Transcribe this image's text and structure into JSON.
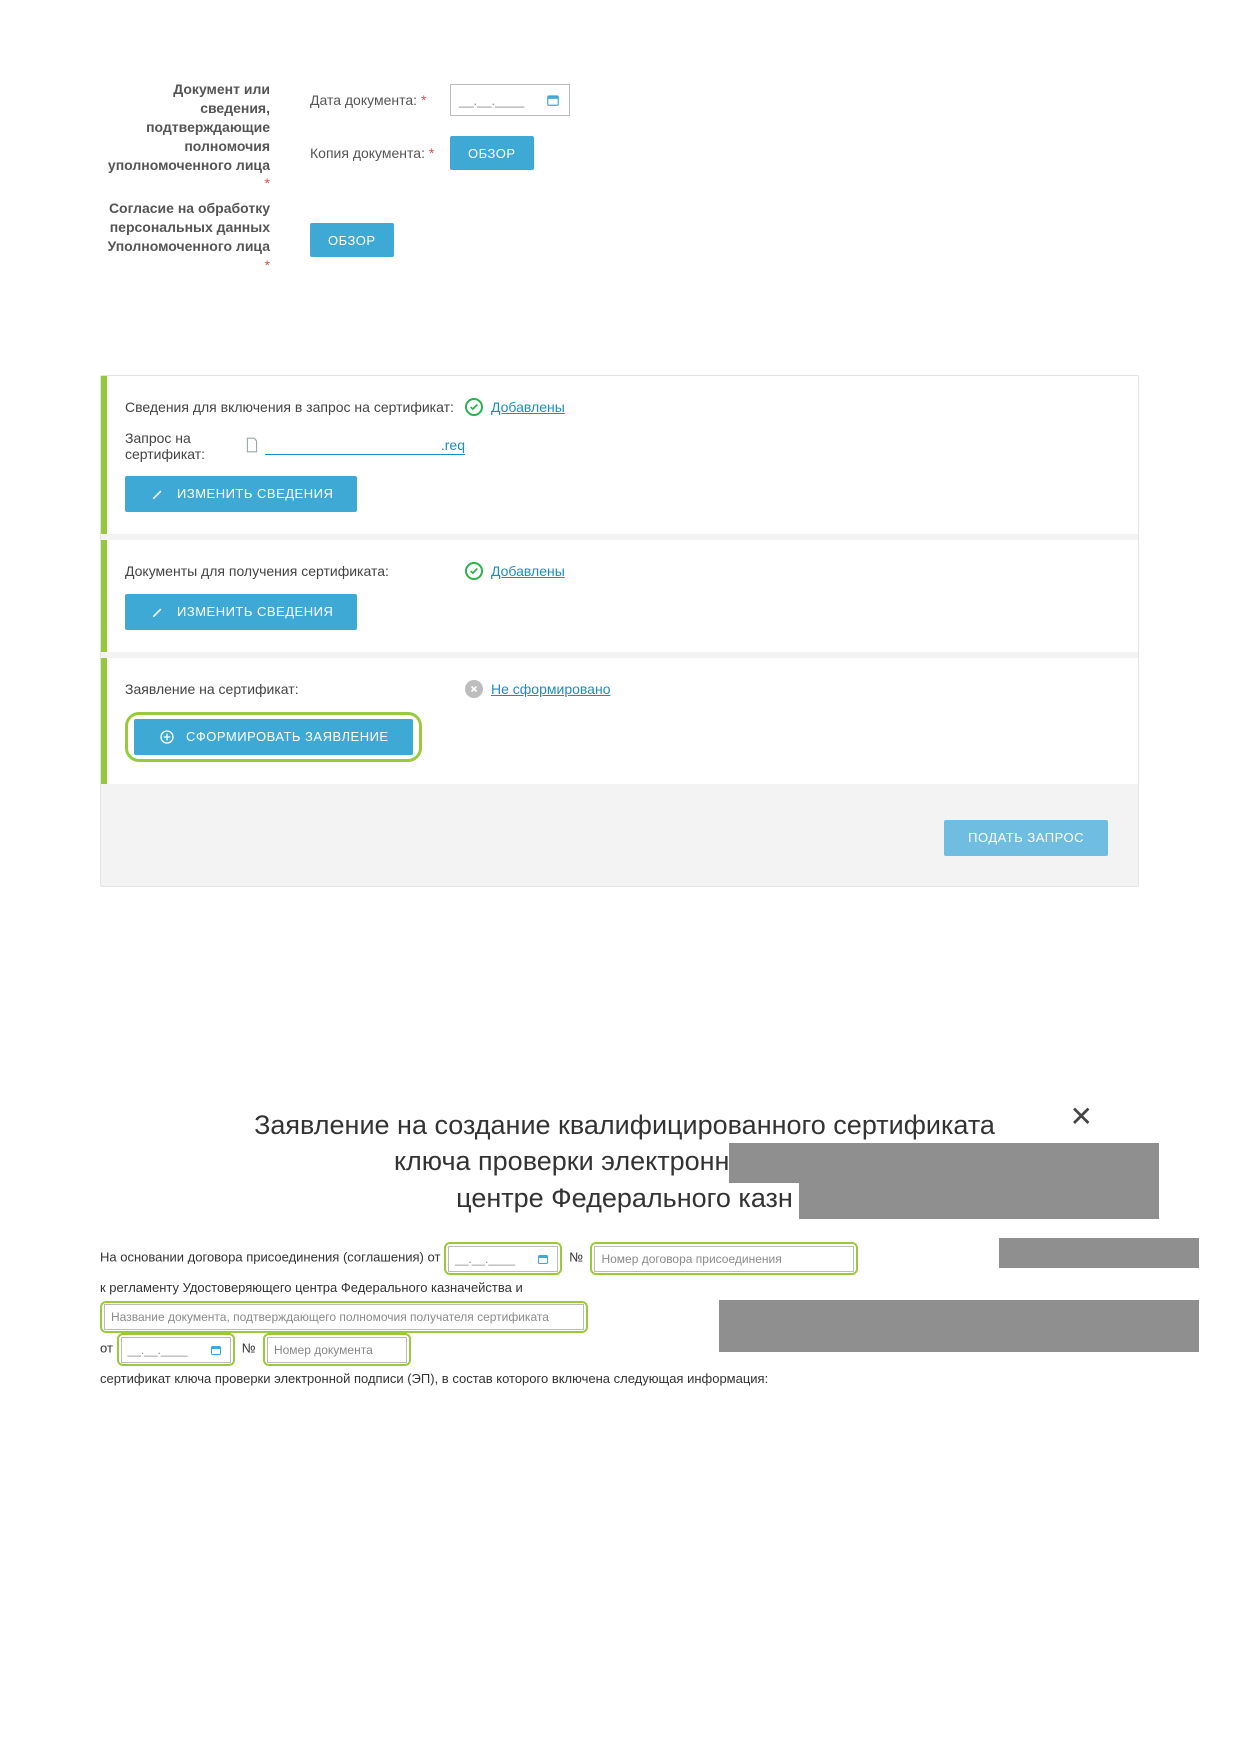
{
  "upload": {
    "doc_authority_label": "Документ или сведения, подтверждающие полномочия уполномоченного лица",
    "doc_date_label": "Дата документа:",
    "doc_copy_label": "Копия документа:",
    "browse": "ОБЗОР",
    "consent_label": "Согласие на обработку персональных данных Уполномоченного лица",
    "date_placeholder": "__.__.____"
  },
  "panel": {
    "cert_info_label": "Сведения для включения в запрос на сертификат:",
    "cert_request_label": "Запрос на сертификат:",
    "cert_request_ext": ".req",
    "cert_docs_label": "Документы для получения сертификата:",
    "cert_statement_label": "Заявление на сертификат:",
    "status_added": "Добавлены",
    "status_not_formed": "Не сформировано",
    "edit_btn": "ИЗМЕНИТЬ СВЕДЕНИЯ",
    "form_statement_btn": "СФОРМИРОВАТЬ ЗАЯВЛЕНИЕ",
    "submit_btn": "ПОДАТЬ ЗАПРОС"
  },
  "modal": {
    "title_l1": "Заявление на создание квалифицированного сертификата",
    "title_l2": "ключа проверки электронной подпис",
    "title_l3": "центре Федерального казн",
    "text1a": "На основании договора присоединения (соглашения) от",
    "num_label": "№",
    "contract_num_ph": "Номер договора присоединения",
    "text1b": "к регламенту Удостоверяющего центра Федерального казначейства и",
    "doc_name_ph": "Название документа, подтверждающего полномочия получателя сертификата",
    "text2a": "от",
    "doc_num_ph": "Номер документа",
    "text3": "сертификат ключа проверки электронной подписи (ЭП), в состав которого включена следующая информация:",
    "date_ph": "__.__.____"
  }
}
